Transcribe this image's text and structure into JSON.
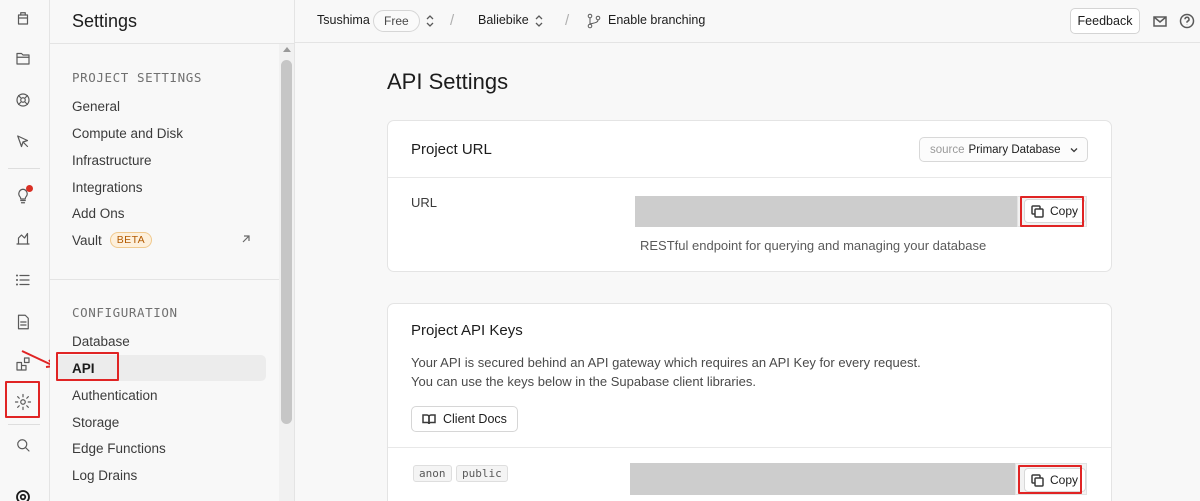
{
  "topbar": {
    "org": "Tsushima",
    "plan_badge": "Free",
    "project": "Baliebike",
    "branching": "Enable branching",
    "feedback": "Feedback",
    "icons": [
      "chevrons-up-down-icon",
      "git-branch-icon",
      "inbox-icon",
      "help-icon"
    ]
  },
  "rail": {
    "icons": [
      "table-editor-icon",
      "sql-editor-icon",
      "database-icon",
      "cursor-icon",
      "lightbulb-icon",
      "reports-icon",
      "logs-icon",
      "api-docs-icon",
      "integrations-icon",
      "settings-icon",
      "search-icon",
      "profile-icon"
    ]
  },
  "sidebar": {
    "title": "Settings",
    "project_settings_heading": "PROJECT SETTINGS",
    "project_items": [
      {
        "label": "General"
      },
      {
        "label": "Compute and Disk"
      },
      {
        "label": "Infrastructure"
      },
      {
        "label": "Integrations"
      },
      {
        "label": "Add Ons"
      },
      {
        "label": "Vault",
        "badge": "BETA"
      }
    ],
    "configuration_heading": "CONFIGURATION",
    "config_items": [
      {
        "label": "Database"
      },
      {
        "label": "API",
        "active": true
      },
      {
        "label": "Authentication"
      },
      {
        "label": "Storage"
      },
      {
        "label": "Edge Functions"
      },
      {
        "label": "Log Drains"
      }
    ]
  },
  "main": {
    "page_title": "API Settings",
    "project_url": {
      "title": "Project URL",
      "source_prefix": "source",
      "source_value": "Primary Database",
      "url_label": "URL",
      "copy_label": "Copy",
      "helper": "RESTful endpoint for querying and managing your database"
    },
    "api_keys": {
      "title": "Project API Keys",
      "description_line1": "Your API is secured behind an API gateway which requires an API Key for every request.",
      "description_line2": "You can use the keys below in the Supabase client libraries.",
      "docs_button": "Client Docs",
      "tag_anon": "anon",
      "tag_public": "public",
      "copy_label": "Copy"
    }
  },
  "colors": {
    "highlight": "#e02424",
    "badge_beta": "#b35a00",
    "notification_dot": "#d93025"
  }
}
